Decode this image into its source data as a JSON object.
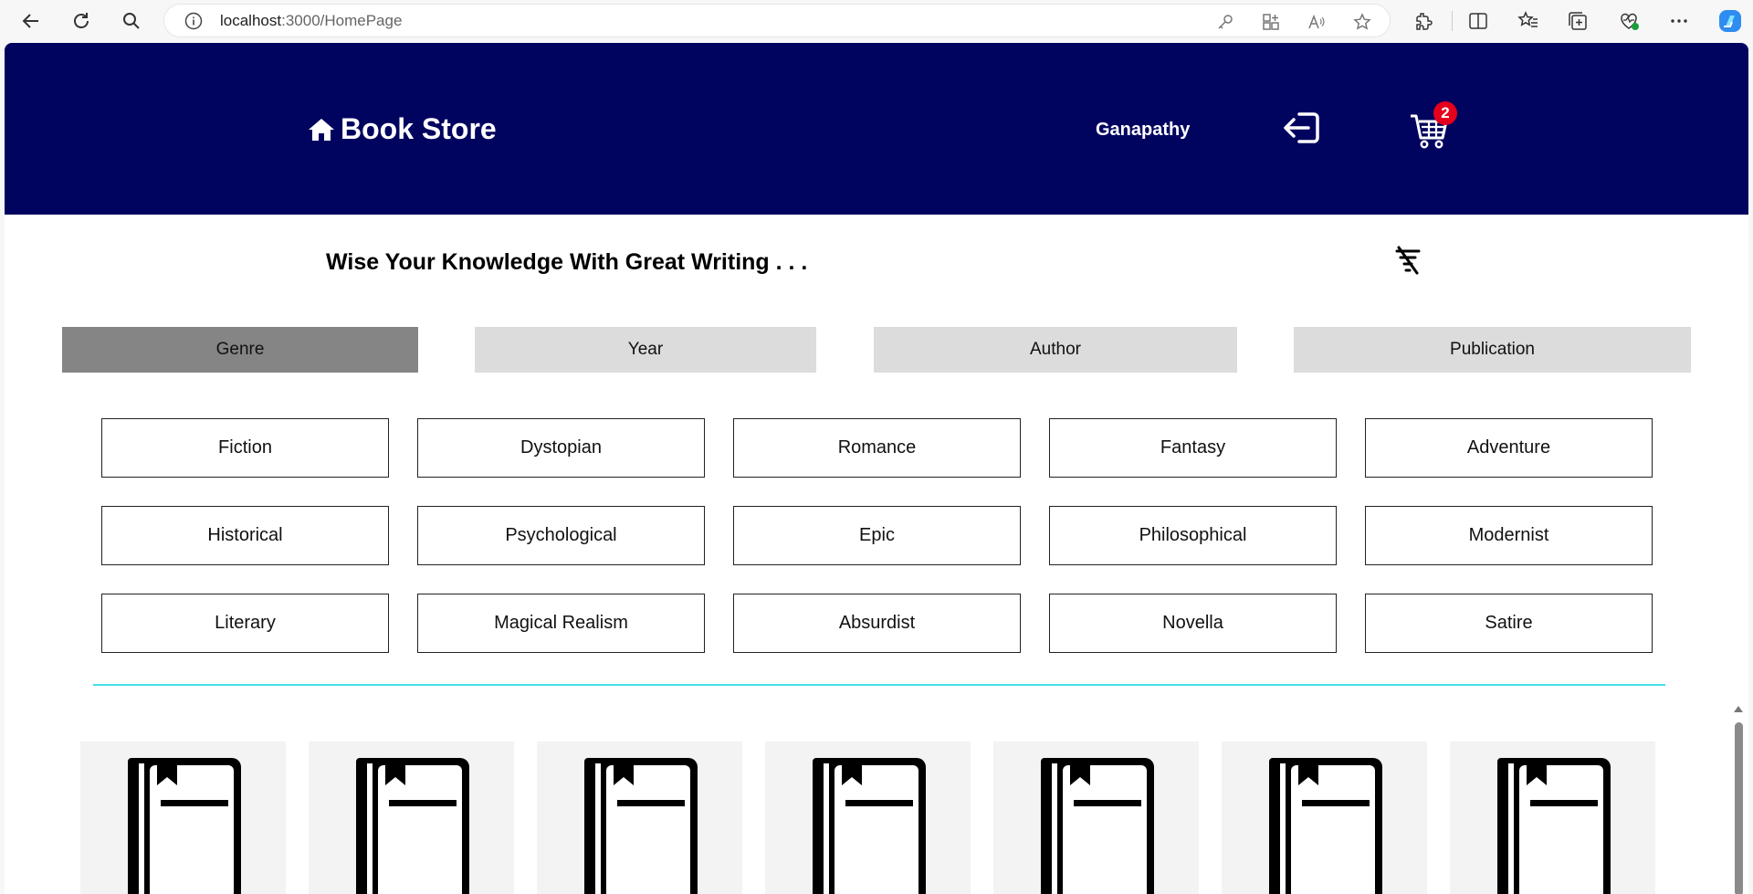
{
  "browser": {
    "url_host": "localhost",
    "url_path": ":3000/HomePage"
  },
  "header": {
    "brand": "Book Store",
    "username": "Ganapathy",
    "cart_count": "2"
  },
  "tagline": "Wise Your Knowledge With Great Writing . . .",
  "filter_tabs": [
    "Genre",
    "Year",
    "Author",
    "Publication"
  ],
  "active_tab": "Genre",
  "genres": [
    "Fiction",
    "Dystopian",
    "Romance",
    "Fantasy",
    "Adventure",
    "Historical",
    "Psychological",
    "Epic",
    "Philosophical",
    "Modernist",
    "Literary",
    "Magical Realism",
    "Absurdist",
    "Novella",
    "Satire"
  ],
  "colors": {
    "header_bg": "#00045f",
    "active_tab": "#858585",
    "inactive_tab": "#dcdcdc",
    "divider": "#43e0e8",
    "badge": "#e4001c"
  },
  "book_cards_visible": 7,
  "icons": {
    "brand": "home-icon",
    "logout": "logout-icon",
    "cart": "cart-icon",
    "filter": "filter-off-icon",
    "book": "book-icon"
  }
}
